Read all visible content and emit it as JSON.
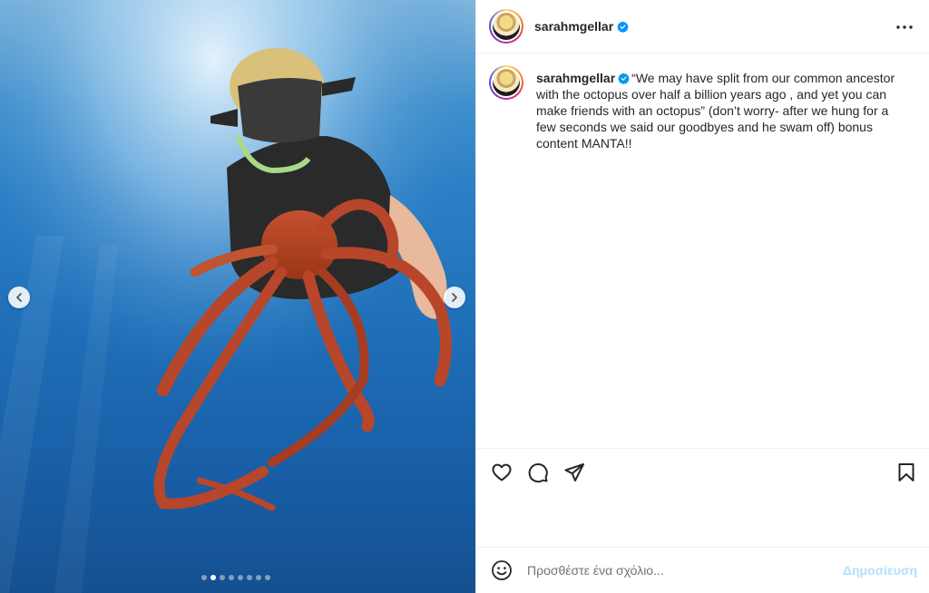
{
  "post": {
    "username": "sarahmgellar",
    "verified": true,
    "caption": "“We may have split from our common ancestor with the octopus over half a billion years ago , and yet you can make friends with an octopus” (don’t worry- after we hung for a few seconds we said our goodbyes and he swam off) bonus content MANTA!!"
  },
  "carousel": {
    "total_slides": 8,
    "active_index": 1
  },
  "icons": {
    "more": "more-options-icon",
    "verified": "verified-badge-icon",
    "like": "heart-icon",
    "comment": "comment-icon",
    "share": "share-icon",
    "save": "bookmark-icon",
    "emoji": "emoji-icon",
    "prev": "chevron-left-icon",
    "next": "chevron-right-icon"
  },
  "comment_bar": {
    "placeholder": "Προσθέστε ένα σχόλιο...",
    "post_label": "Δημοσίευση"
  },
  "colors": {
    "verified_blue": "#0095f6",
    "post_button_disabled": "#b2dffc",
    "text": "#262626",
    "divider": "#efefef"
  }
}
